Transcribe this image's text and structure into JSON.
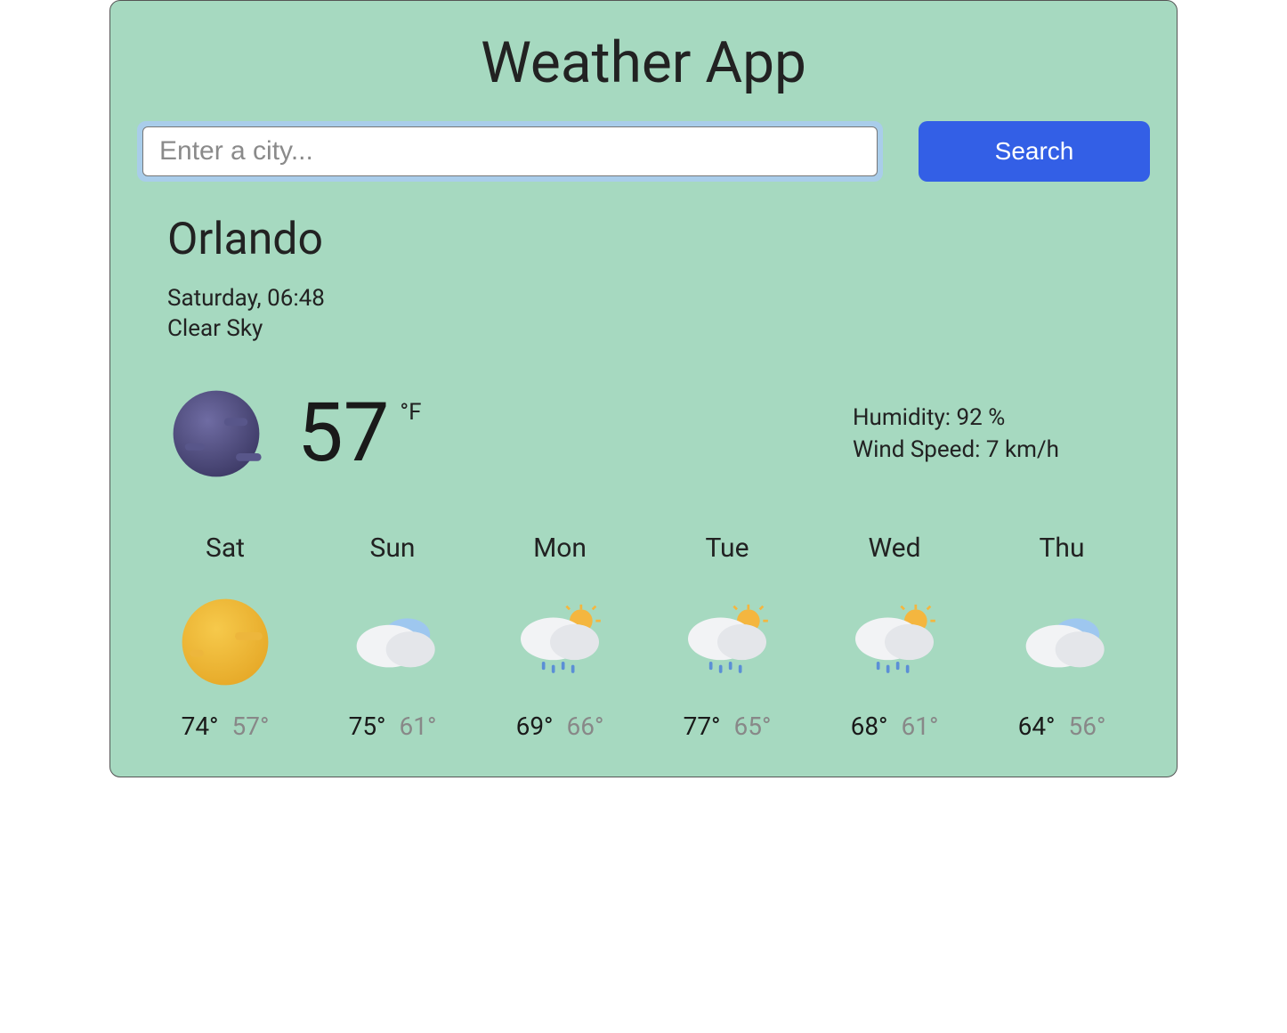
{
  "app": {
    "title": "Weather App"
  },
  "search": {
    "placeholder": "Enter a city...",
    "button_label": "Search",
    "value": ""
  },
  "current": {
    "city": "Orlando",
    "datetime": "Saturday, 06:48",
    "condition": "Clear Sky",
    "temperature": "57",
    "unit": "°F",
    "humidity_label": "Humidity: 92 %",
    "wind_label": "Wind Speed: 7 km/h",
    "icon": "night-clear"
  },
  "forecast": [
    {
      "day": "Sat",
      "icon": "sun",
      "high": "74°",
      "low": "57°"
    },
    {
      "day": "Sun",
      "icon": "cloudy",
      "high": "75°",
      "low": "61°"
    },
    {
      "day": "Mon",
      "icon": "rain-partly-sunny",
      "high": "69°",
      "low": "66°"
    },
    {
      "day": "Tue",
      "icon": "rain-partly-sunny",
      "high": "77°",
      "low": "65°"
    },
    {
      "day": "Wed",
      "icon": "rain-partly-sunny",
      "high": "68°",
      "low": "61°"
    },
    {
      "day": "Thu",
      "icon": "cloudy",
      "high": "64°",
      "low": "56°"
    }
  ]
}
